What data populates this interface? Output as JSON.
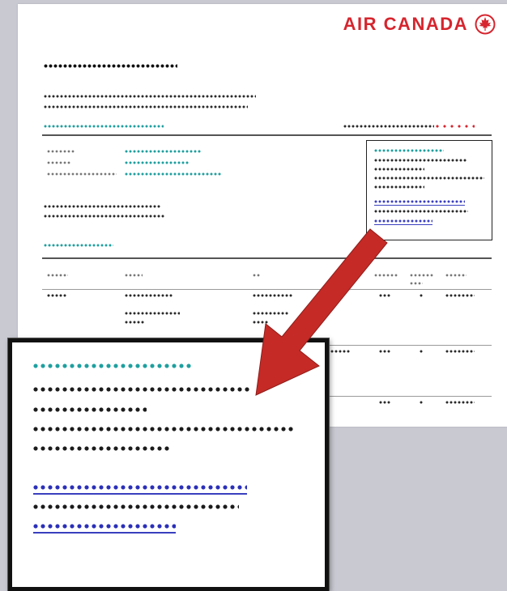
{
  "brand": {
    "name": "AIR CANADA",
    "color": "#d6252e",
    "icon": "maple-leaf-icon"
  },
  "colors": {
    "background": "#c9c9d2",
    "page": "#ffffff",
    "accent_teal": "#1f9f9f",
    "link_blue": "#3a3fbf",
    "arrow_red": "#c62a26"
  }
}
